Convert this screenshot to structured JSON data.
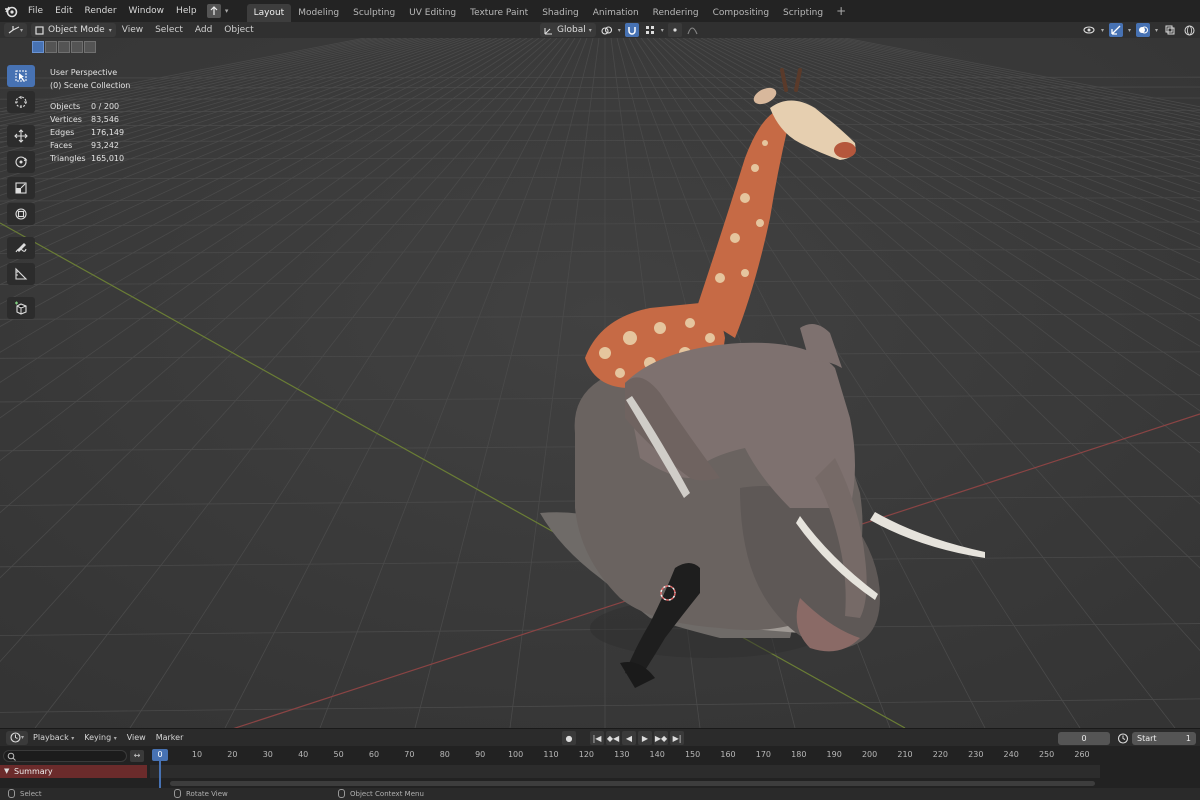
{
  "menu": {
    "items": [
      "File",
      "Edit",
      "Render",
      "Window",
      "Help"
    ],
    "upload_icon": "upload-arrow-icon"
  },
  "workspaces": {
    "tabs": [
      "Layout",
      "Modeling",
      "Sculpting",
      "UV Editing",
      "Texture Paint",
      "Shading",
      "Animation",
      "Rendering",
      "Compositing",
      "Scripting"
    ],
    "active": "Layout",
    "add_label": "+"
  },
  "viewport_header": {
    "mode": "Object Mode",
    "menus": [
      "View",
      "Select",
      "Add",
      "Object"
    ],
    "transform_orientation": "Global"
  },
  "overlay": {
    "perspective": "User Perspective",
    "collection": "(0) Scene Collection",
    "stats": [
      {
        "label": "Objects",
        "value": "0 / 200"
      },
      {
        "label": "Vertices",
        "value": "83,546"
      },
      {
        "label": "Edges",
        "value": "176,149"
      },
      {
        "label": "Faces",
        "value": "93,242"
      },
      {
        "label": "Triangles",
        "value": "165,010"
      }
    ]
  },
  "toolbar": {
    "tools": [
      "select-box-icon",
      "cursor-icon",
      "move-icon",
      "rotate-icon",
      "scale-icon",
      "transform-icon",
      "annotate-icon",
      "measure-icon",
      "add-cube-icon"
    ],
    "active_tool": "select-box-icon"
  },
  "timeline": {
    "menus": [
      "Playback",
      "Keying",
      "View",
      "Marker"
    ],
    "current_frame": "0",
    "frame_field": "0",
    "start_label": "Start",
    "start_value": "1",
    "ruler_labels": [
      "10",
      "20",
      "30",
      "40",
      "50",
      "60",
      "70",
      "80",
      "90",
      "100",
      "110",
      "120",
      "130",
      "140",
      "150",
      "160",
      "170",
      "180",
      "190",
      "200",
      "210",
      "220",
      "230",
      "240",
      "250",
      "260"
    ],
    "summary_label": "Summary",
    "swap_label": "↔"
  },
  "statusbar": {
    "items": [
      "Select",
      "Rotate View",
      "Object Context Menu"
    ]
  },
  "colors": {
    "accent": "#4772b3",
    "viewport_bg": "#3d3d3d",
    "summary_bg": "#6b2b2b"
  }
}
